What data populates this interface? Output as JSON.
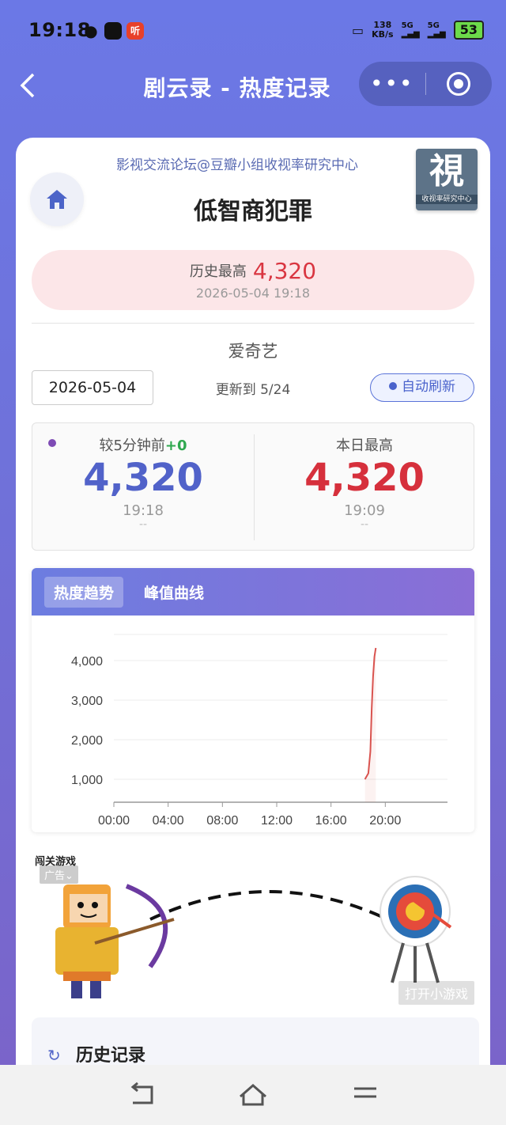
{
  "status_bar": {
    "time": "19:18",
    "net_speed_value": "138",
    "net_speed_unit": "KB/s",
    "signal1": "5G",
    "signal2": "5G",
    "battery": "53",
    "app_icon_text": "听"
  },
  "nav": {
    "title": "剧云录 - 热度记录",
    "more_label": "•••"
  },
  "header": {
    "forum": "影视交流论坛@豆瓣小组收视率研究中心",
    "logo_char": "視",
    "logo_caption": "收视率研究中心",
    "show_title": "低智商犯罪"
  },
  "peak": {
    "label": "历史最高",
    "value": "4,320",
    "time": "2026-05-04 19:18"
  },
  "platform": "爱奇艺",
  "controls": {
    "date": "2026-05-04",
    "update_text": "更新到 5/24",
    "auto_refresh": "自动刷新"
  },
  "stats": {
    "compare_label": "较5分钟前",
    "compare_delta": "+0",
    "current_value": "4,320",
    "current_time": "19:18",
    "current_sub": "--",
    "daily_label": "本日最高",
    "daily_value": "4,320",
    "daily_time": "19:09",
    "daily_sub": "--"
  },
  "chart_tabs": {
    "tab1": "热度趋势",
    "tab2": "峰值曲线"
  },
  "chart_data": {
    "type": "line",
    "title": "",
    "xlabel": "",
    "ylabel": "",
    "x_ticks": [
      "00:00",
      "04:00",
      "08:00",
      "12:00",
      "16:00",
      "20:00"
    ],
    "y_ticks": [
      "1,000",
      "2,000",
      "3,000",
      "4,000"
    ],
    "xlim": [
      0,
      24
    ],
    "ylim": [
      700,
      4700
    ],
    "grid": true,
    "series": [
      {
        "color": "#d9534f",
        "x": [
          18.5,
          18.75,
          18.9,
          19.0,
          19.1,
          19.2,
          19.3
        ],
        "y": [
          1000,
          1150,
          1700,
          2800,
          3600,
          4100,
          4320
        ]
      }
    ]
  },
  "ad": {
    "tag": "闯关游戏",
    "badge": "广告",
    "open_game": "打开小游戏"
  },
  "history": {
    "title": "历史记录"
  }
}
